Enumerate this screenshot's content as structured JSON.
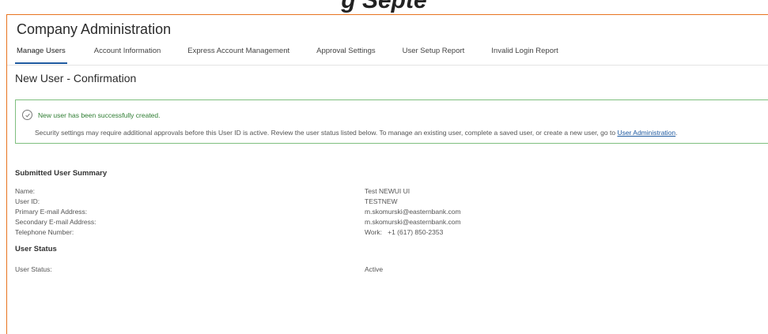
{
  "top_caption": "g Septe",
  "app": {
    "title": "Company Administration"
  },
  "tabs": [
    {
      "label": "Manage Users"
    },
    {
      "label": "Account Information"
    },
    {
      "label": "Express Account Management"
    },
    {
      "label": "Approval Settings"
    },
    {
      "label": "User Setup Report"
    },
    {
      "label": "Invalid Login Report"
    }
  ],
  "page": {
    "heading": "New User - Confirmation"
  },
  "alert": {
    "title": "New user has been successfully created.",
    "message": "Security settings may require additional approvals before this User ID is active. Review the user status listed below. To manage an existing user, complete a saved user, or create a new user, go to",
    "link": "User Administration",
    "suffix": "."
  },
  "summary": {
    "title": "Submitted User Summary",
    "rows": [
      {
        "label": "Name:",
        "value": "Test NEWUI UI"
      },
      {
        "label": "User ID:",
        "value": "TESTNEW"
      },
      {
        "label": "Primary E-mail Address:",
        "value": "m.skomurski@easternbank.com"
      },
      {
        "label": "Secondary E-mail Address:",
        "value": "m.skomurski@easternbank.com"
      },
      {
        "label": "Telephone Number:",
        "value": "Work:   +1 (617) 850-2353"
      }
    ]
  },
  "status": {
    "title": "User Status",
    "label": "User Status:",
    "value": "Active"
  },
  "colors": {
    "accent": "#1f5aa0",
    "success_border": "#7fbf7f",
    "success_text": "#2e7d32",
    "frame_border": "#e8731f"
  }
}
